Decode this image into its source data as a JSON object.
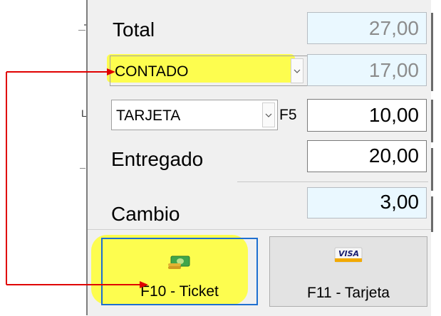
{
  "payment": {
    "total_label": "Total",
    "total_value": "27,00",
    "contado_option": "CONTADO",
    "contado_value": "17,00",
    "tarjeta_option": "TARJETA",
    "tarjeta_shortcut": "F5",
    "tarjeta_value": "10,00",
    "entregado_label": "Entregado",
    "entregado_value": "20,00",
    "cambio_label": "Cambio",
    "cambio_value": "3,00"
  },
  "buttons": {
    "ticket_label": "F10 - Ticket",
    "ticket_icon": "cash-icon",
    "tarjeta_label": "F11 - Tarjeta",
    "tarjeta_icon": "visa-card-icon",
    "visa_text": "VISA"
  },
  "left_panel": {
    "clipped_text": "L"
  },
  "colors": {
    "highlight": "#ffff33",
    "arrow": "#e00000",
    "readonly_bg": "#eaf8ff",
    "focus_border": "#1e6fd0"
  }
}
